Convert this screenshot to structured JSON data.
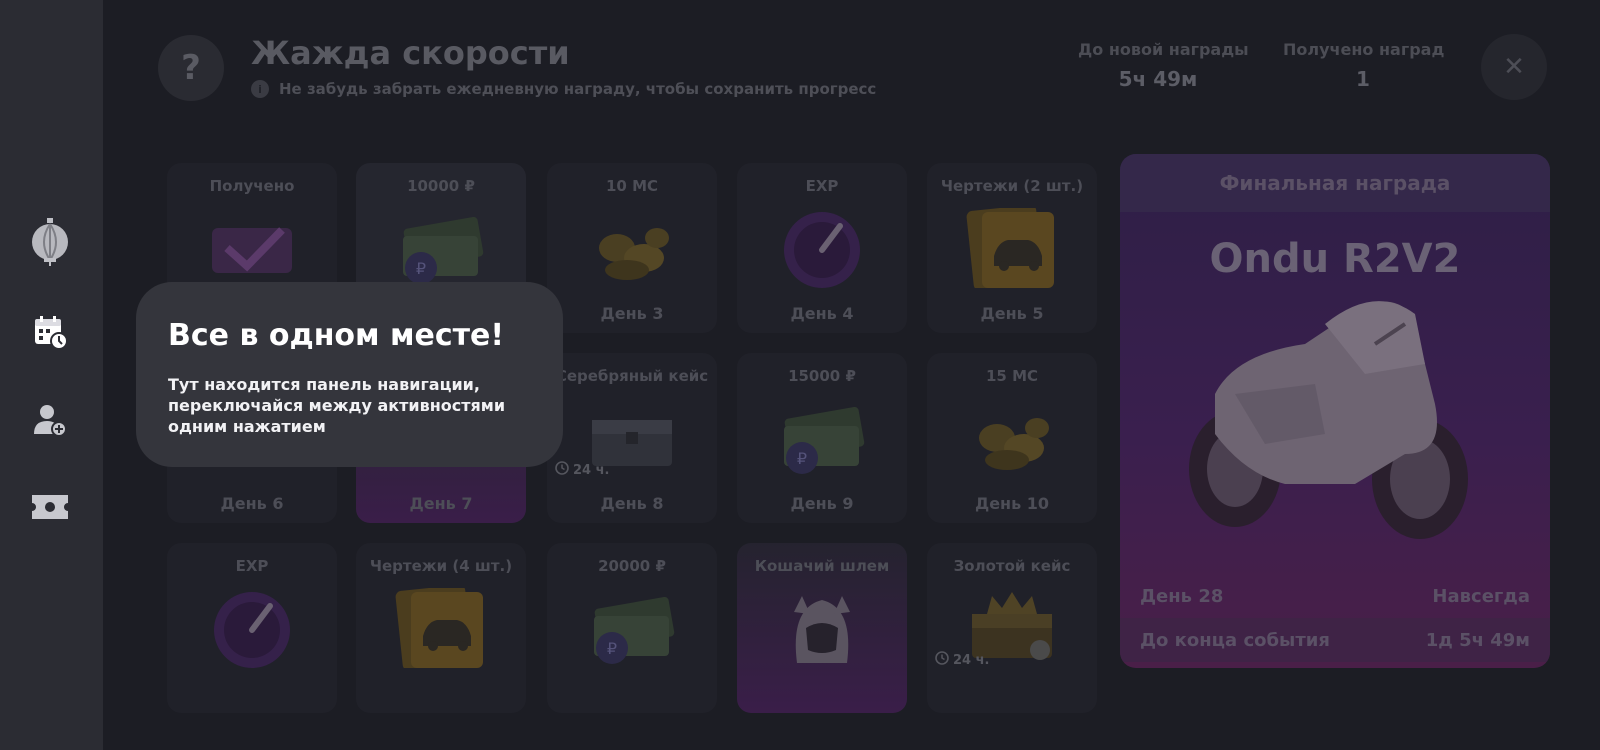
{
  "sidebar": {
    "items": [
      {
        "icon": "lantern-icon"
      },
      {
        "icon": "calendar-clock-icon"
      },
      {
        "icon": "user-add-icon"
      },
      {
        "icon": "ticket-icon"
      }
    ]
  },
  "header": {
    "help_glyph": "?",
    "title": "Жажда скорости",
    "info_glyph": "i",
    "subtitle": "Не забудь забрать ежедневную награду, чтобы сохранить прогресс",
    "next_reward_label": "До новой награды",
    "next_reward_value": "5ч 49м",
    "received_label": "Получено наград",
    "received_value": "1",
    "close_glyph": "✕"
  },
  "cards": [
    {
      "title": "Получено",
      "day": "",
      "art": "check"
    },
    {
      "title": "10000 ₽",
      "day": "",
      "art": "money"
    },
    {
      "title": "10 MC",
      "day": "День 3",
      "art": "coins"
    },
    {
      "title": "EXP",
      "day": "День 4",
      "art": "exp"
    },
    {
      "title": "Чертежи (2 шт.)",
      "day": "День 5",
      "art": "blueprint"
    },
    {
      "title": "",
      "day": "День 6",
      "art": "none"
    },
    {
      "title": "",
      "day": "День 7",
      "art": "none"
    },
    {
      "title": "Серебряный кейс",
      "day": "День 8",
      "art": "silver-case",
      "timer": "24 ч."
    },
    {
      "title": "15000 ₽",
      "day": "День 9",
      "art": "money"
    },
    {
      "title": "15 MC",
      "day": "День 10",
      "art": "coins"
    },
    {
      "title": "EXP",
      "day": "",
      "art": "exp"
    },
    {
      "title": "Чертежи (4 шт.)",
      "day": "",
      "art": "blueprint"
    },
    {
      "title": "20000 ₽",
      "day": "",
      "art": "money"
    },
    {
      "title": "Кошачий шлем",
      "day": "",
      "art": "helmet"
    },
    {
      "title": "Золотой кейс",
      "day": "",
      "art": "gold-case",
      "timer": "24 ч."
    }
  ],
  "final_reward": {
    "header": "Финальная награда",
    "name": "Ondu R2V2",
    "day_label": "День 28",
    "duration": "Навсегда",
    "event_end_label": "До конца события",
    "event_end_value": "1д 5ч 49м"
  },
  "tooltip": {
    "title": "Все в одном месте!",
    "text": "Тут находится панель навигации, переключайся между активностями одним нажатием"
  },
  "colors": {
    "background": "#1c1d24",
    "sidebar": "#2b2c33",
    "tooltip": "#34353c",
    "final_reward": "#3a1f4e"
  }
}
